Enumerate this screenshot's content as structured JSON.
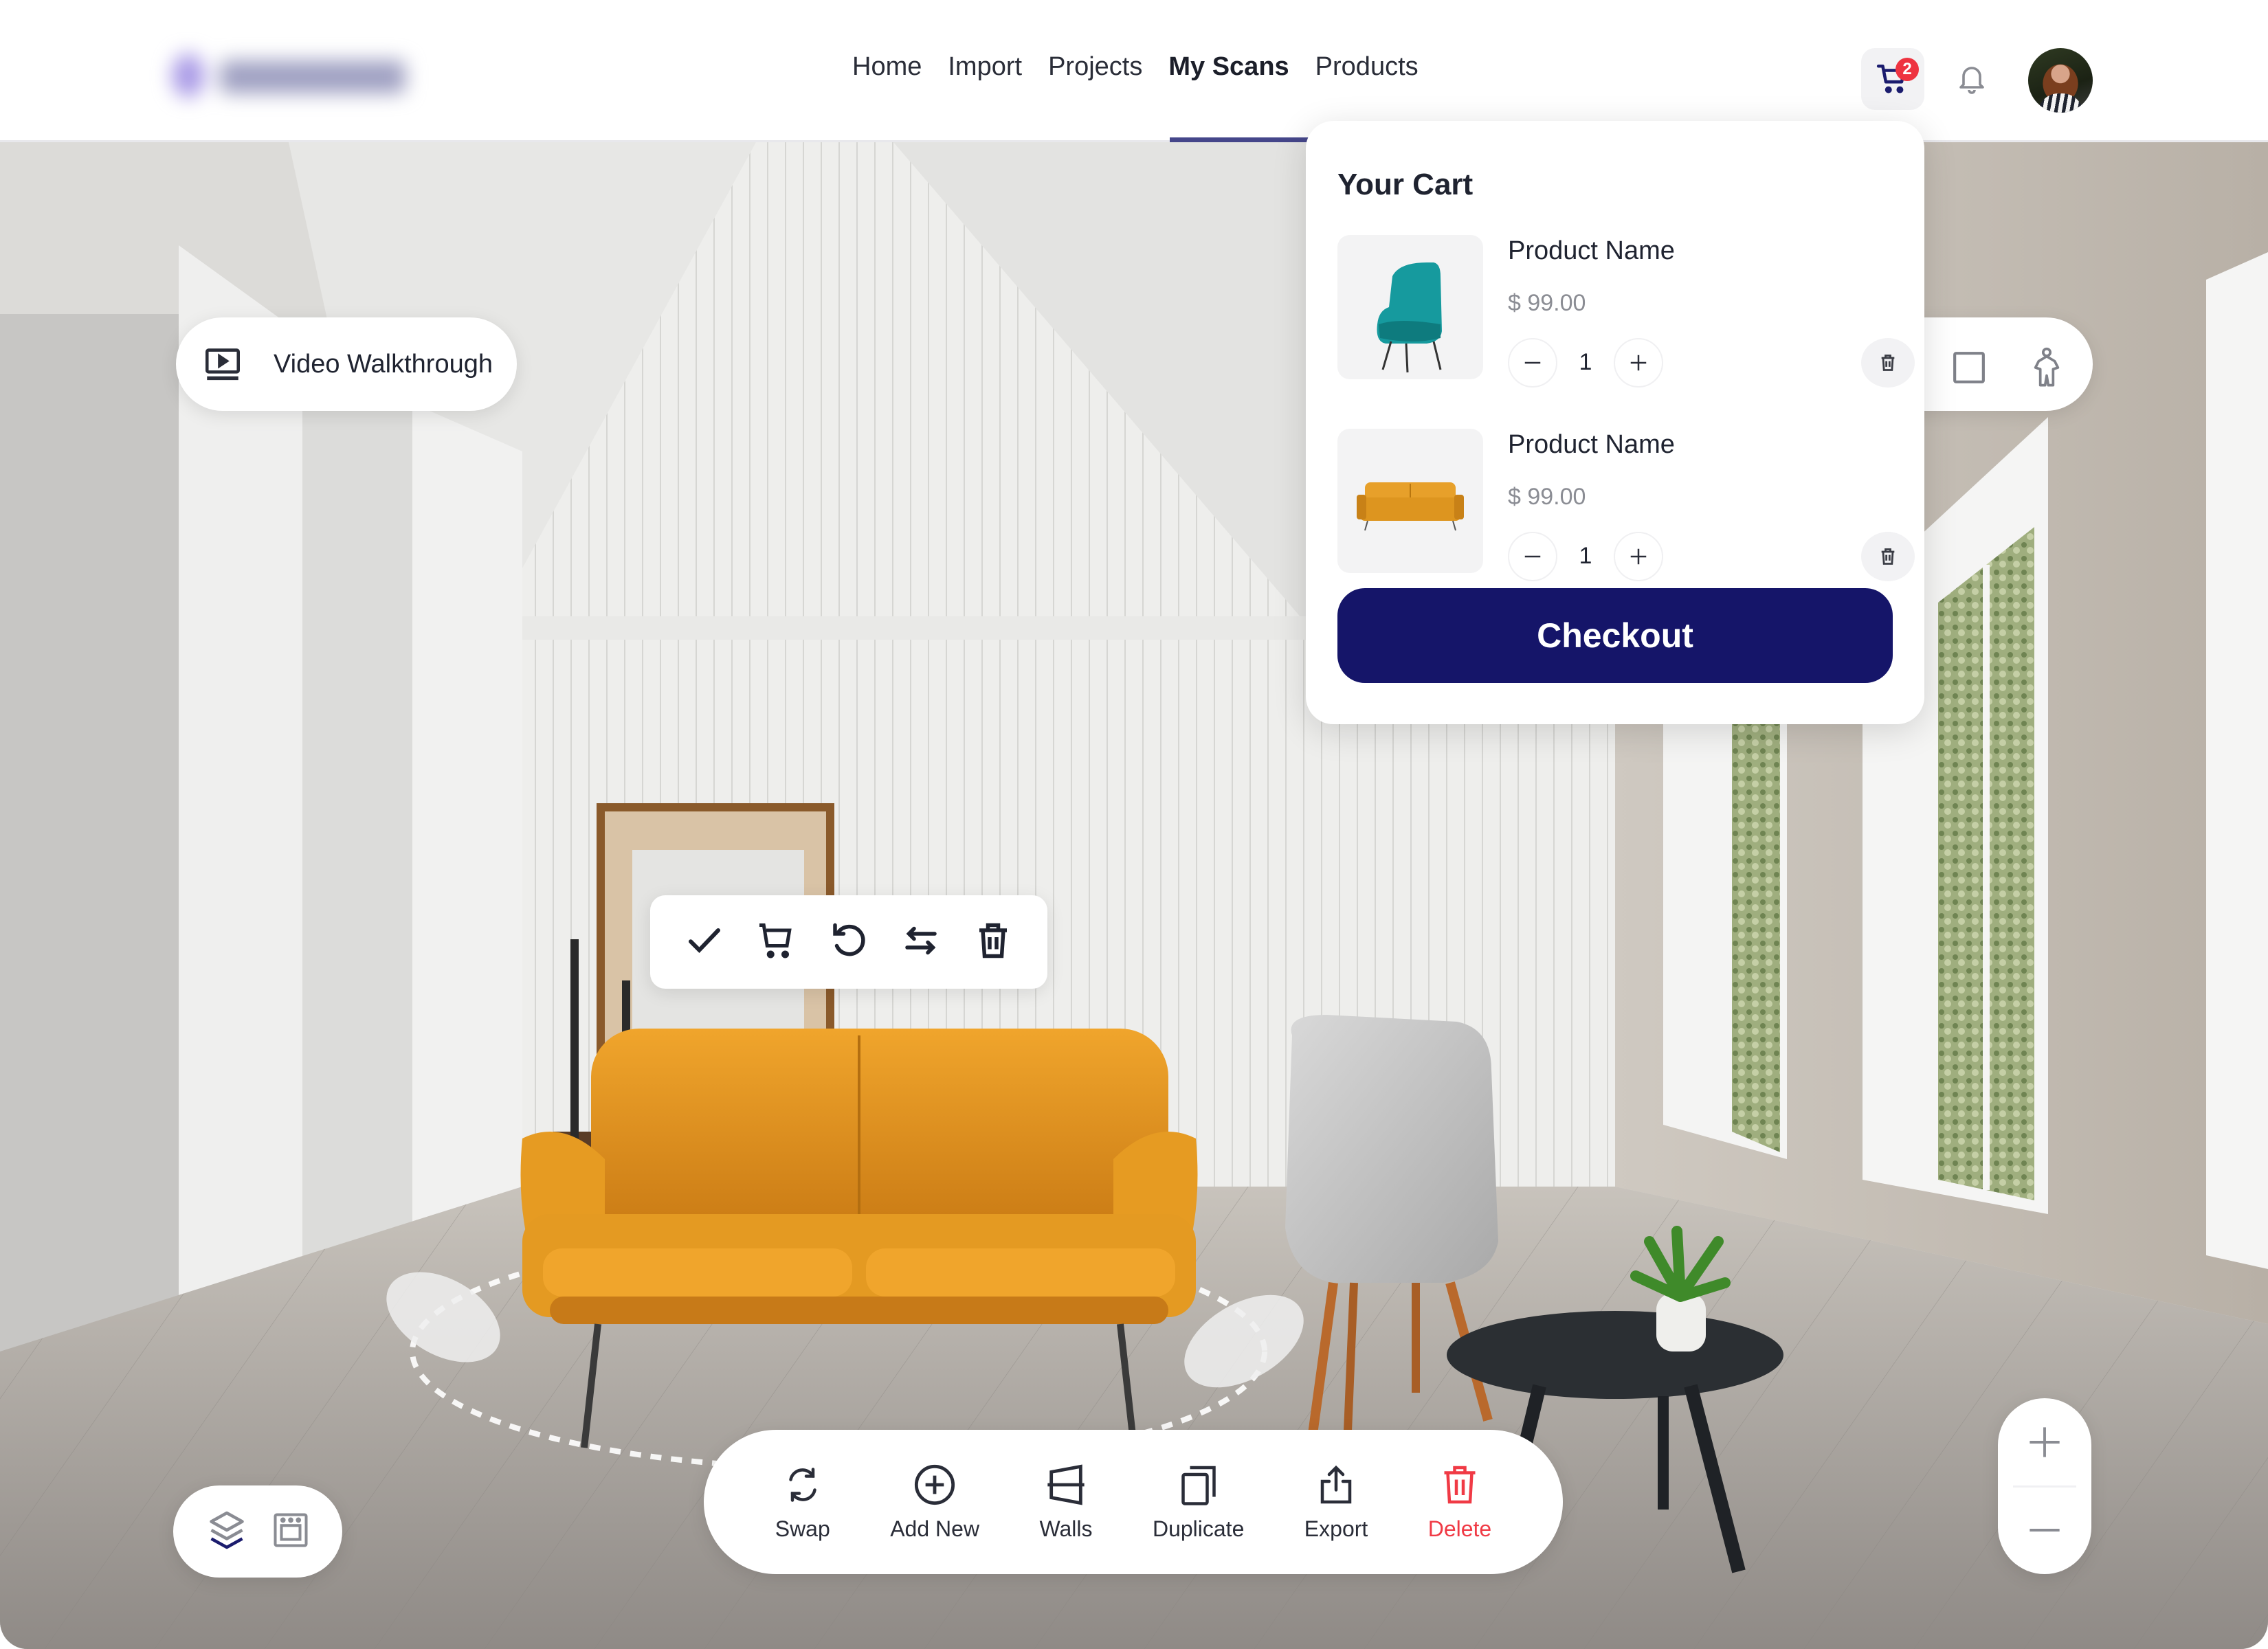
{
  "header": {
    "logo_text": "Designer",
    "nav": [
      {
        "label": "Home",
        "active": false
      },
      {
        "label": "Import",
        "active": false
      },
      {
        "label": "Projects",
        "active": false
      },
      {
        "label": "My Scans",
        "active": true
      },
      {
        "label": "Products",
        "active": false
      }
    ],
    "cart_icon": "cart-icon",
    "cart_count": "2",
    "bell_icon": "bell-icon",
    "avatar_icon": "user-avatar"
  },
  "scene": {
    "video_walkthrough": {
      "label": "Video Walkthrough",
      "icon": "video-play-icon"
    },
    "view_controls": [
      {
        "name": "orbit-view",
        "icon": "orbit-icon"
      },
      {
        "name": "2d-view",
        "icon": "square-icon"
      },
      {
        "name": "person-view",
        "icon": "person-icon"
      }
    ],
    "object_toolbar": [
      {
        "name": "confirm",
        "icon": "check-icon"
      },
      {
        "name": "add-to-cart",
        "icon": "cart-icon"
      },
      {
        "name": "rotate",
        "icon": "rotate-icon"
      },
      {
        "name": "swap",
        "icon": "swap-arrows-icon"
      },
      {
        "name": "delete",
        "icon": "trash-icon"
      }
    ],
    "bottom_toolbar": [
      {
        "label": "Swap",
        "icon": "swap-icon"
      },
      {
        "label": "Add New",
        "icon": "add-circle-icon"
      },
      {
        "label": "Walls",
        "icon": "walls-icon"
      },
      {
        "label": "Duplicate",
        "icon": "duplicate-icon"
      },
      {
        "label": "Export",
        "icon": "export-icon"
      },
      {
        "label": "Delete",
        "icon": "trash-icon",
        "color": "#f03a45"
      }
    ],
    "layers_controls": [
      {
        "name": "layers",
        "icon": "layers-icon"
      },
      {
        "name": "appliance",
        "icon": "oven-icon"
      }
    ],
    "zoom": {
      "in_label": "+",
      "out_label": "−"
    }
  },
  "cart": {
    "title": "Your Cart",
    "items": [
      {
        "name": "Product Name",
        "price": "$ 99.00",
        "quantity": "1",
        "image": "teal-chair"
      },
      {
        "name": "Product Name",
        "price": "$ 99.00",
        "quantity": "1",
        "image": "orange-sofa"
      }
    ],
    "checkout_label": "Checkout"
  },
  "colors": {
    "brand_navy": "#151569",
    "nav_underline": "#45468a",
    "badge_red": "#ee3340",
    "delete_red": "#f03a45",
    "sofa_orange": "#e39a24"
  }
}
